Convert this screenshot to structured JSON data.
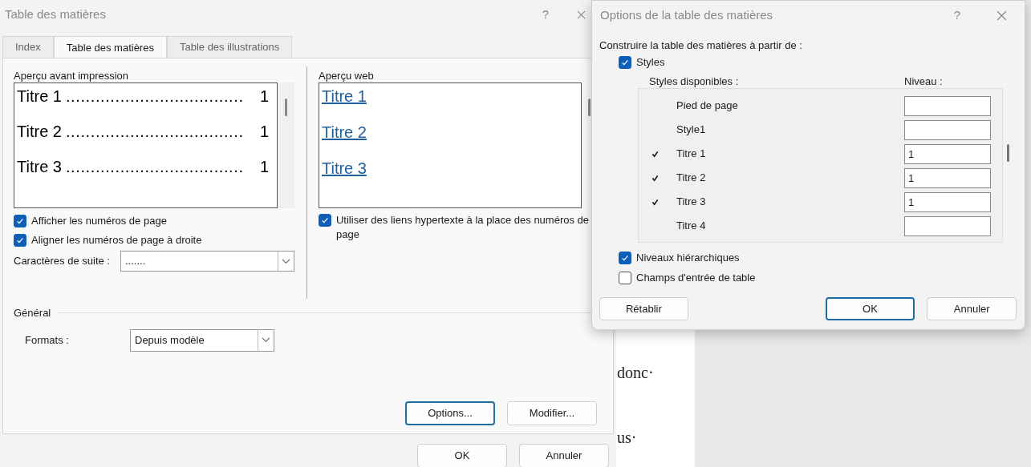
{
  "background_document": {
    "lines": [
      "donc·",
      "us·"
    ]
  },
  "main_dialog": {
    "title": "Table des matières",
    "help": "?",
    "tabs": [
      {
        "label": "Index",
        "selected": false
      },
      {
        "label": "Table des matières",
        "selected": true
      },
      {
        "label": "Table des illustrations",
        "selected": false
      }
    ],
    "print_preview": {
      "label": "Aperçu avant impression",
      "entries": [
        {
          "title": "Titre 1",
          "leader": "....................................",
          "page": "1"
        },
        {
          "title": "Titre 2",
          "leader": "....................................",
          "page": "1"
        },
        {
          "title": "Titre 3",
          "leader": "....................................",
          "page": "1"
        }
      ]
    },
    "print_options": [
      {
        "label": "Afficher les numéros de page",
        "checked": true
      },
      {
        "label": "Aligner les numéros de page à droite",
        "checked": true
      }
    ],
    "tab_leader": {
      "label": "Caractères de suite :",
      "value": "......."
    },
    "web_preview": {
      "label": "Aperçu web",
      "links": [
        "Titre 1",
        "Titre 2",
        "Titre 3"
      ]
    },
    "web_options": [
      {
        "label": "Utiliser des liens hypertexte à la place des numéros de page",
        "checked": true
      }
    ],
    "general": {
      "label": "Général",
      "formats": {
        "label": "Formats :",
        "value": "Depuis modèle"
      }
    },
    "panel_buttons": [
      {
        "label": "Options...",
        "focused": true
      },
      {
        "label": "Modifier...",
        "focused": false
      }
    ],
    "buttons": [
      {
        "label": "OK",
        "focused": false
      },
      {
        "label": "Annuler",
        "focused": false
      }
    ]
  },
  "options_dialog": {
    "title": "Options de la table des matières",
    "help": "?",
    "heading": "Construire la table des matières à partir de :",
    "styles": {
      "label": "Styles",
      "checked": true
    },
    "columns": [
      "Styles disponibles :",
      "Niveau :"
    ],
    "rows": [
      {
        "name": "Pied de page",
        "used": false,
        "level_value": ""
      },
      {
        "name": "Style1",
        "used": false,
        "level_value": ""
      },
      {
        "name": "Titre 1",
        "used": true,
        "level_value": "1"
      },
      {
        "name": "Titre 2",
        "used": true,
        "level_value": "1"
      },
      {
        "name": "Titre 3",
        "used": true,
        "level_value": "1"
      },
      {
        "name": "Titre 4",
        "used": false,
        "level_value": ""
      }
    ],
    "options": [
      {
        "label": "Niveaux hiérarchiques",
        "checked": true
      },
      {
        "label": "Champs d'entrée de table",
        "checked": false
      }
    ],
    "buttons": [
      {
        "label": "Rétablir",
        "focused": false
      },
      {
        "label": "OK",
        "focused": true
      },
      {
        "label": "Annuler",
        "focused": false
      }
    ]
  }
}
